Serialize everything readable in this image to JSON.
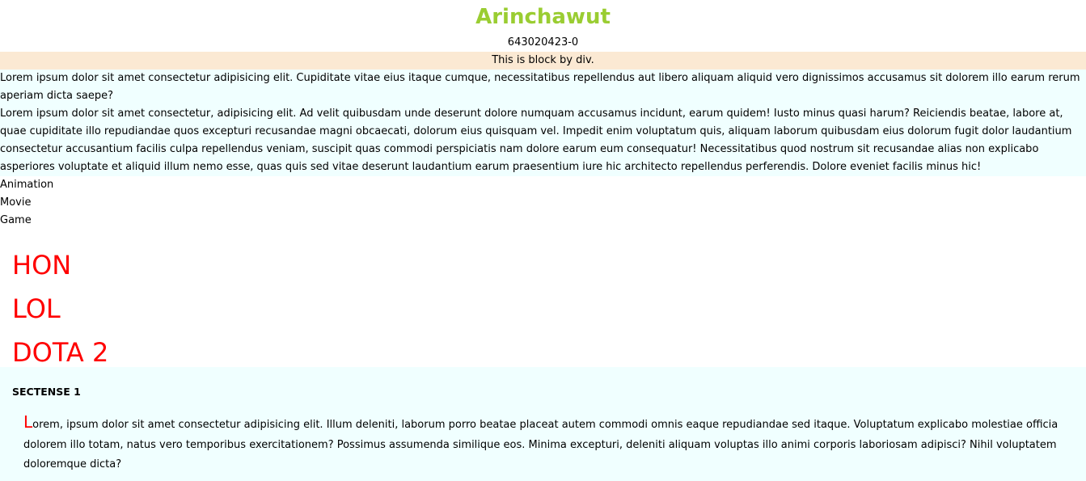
{
  "header": {
    "title": "Arinchawut",
    "student_id": "643020423-0"
  },
  "div_block": {
    "text": "This is block by div."
  },
  "paragraphs": [
    "Lorem ipsum dolor sit amet consectetur adipisicing elit. Cupiditate vitae eius itaque cumque, necessitatibus repellendus aut libero aliquam aliquid vero dignissimos accusamus sit dolorem illo earum rerum aperiam dicta saepe?",
    "Lorem ipsum dolor sit amet consectetur, adipisicing elit. Ad velit quibusdam unde deserunt dolore numquam accusamus incidunt, earum quidem! Iusto minus quasi harum? Reiciendis beatae, labore at, quae cupiditate illo repudiandae quos excepturi recusandae magni obcaecati, dolorum eius quisquam vel. Impedit enim voluptatum quis, aliquam laborum quibusdam eius dolorum fugit dolor laudantium consectetur accusantium facilis culpa repellendus veniam, suscipit quas commodi perspiciatis nam dolore earum eum consequatur! Necessitatibus quod nostrum sit recusandae alias non explicabo asperiores voluptate et aliquid illum nemo esse, quas quis sed vitae deserunt laudantium earum praesentium iure hic architecto repellendus perferendis. Dolore eveniet facilis minus hic!"
  ],
  "categories": [
    "Animation",
    "Movie",
    "Game"
  ],
  "games": [
    "HON",
    "LOL",
    "DOTA 2"
  ],
  "section": {
    "title": "SECTENSE 1",
    "dropcap": "L",
    "text": "orem, ipsum dolor sit amet consectetur adipisicing elit. Illum deleniti, laborum porro beatae placeat autem commodi omnis eaque repudiandae sed itaque. Voluptatum explicabo molestiae officia dolorem illo totam, natus vero temporibus exercitationem? Possimus assumenda similique eos. Minima excepturi, deleniti aliquam voluptas illo animi corporis laboriosam adipisci? Nihil voluptatem doloremque dicta?"
  },
  "colors": {
    "title": "#9acd32",
    "div_block_bg": "#fbe9d3",
    "para_bg": "#f0ffff",
    "games_text": "#ff0000"
  }
}
